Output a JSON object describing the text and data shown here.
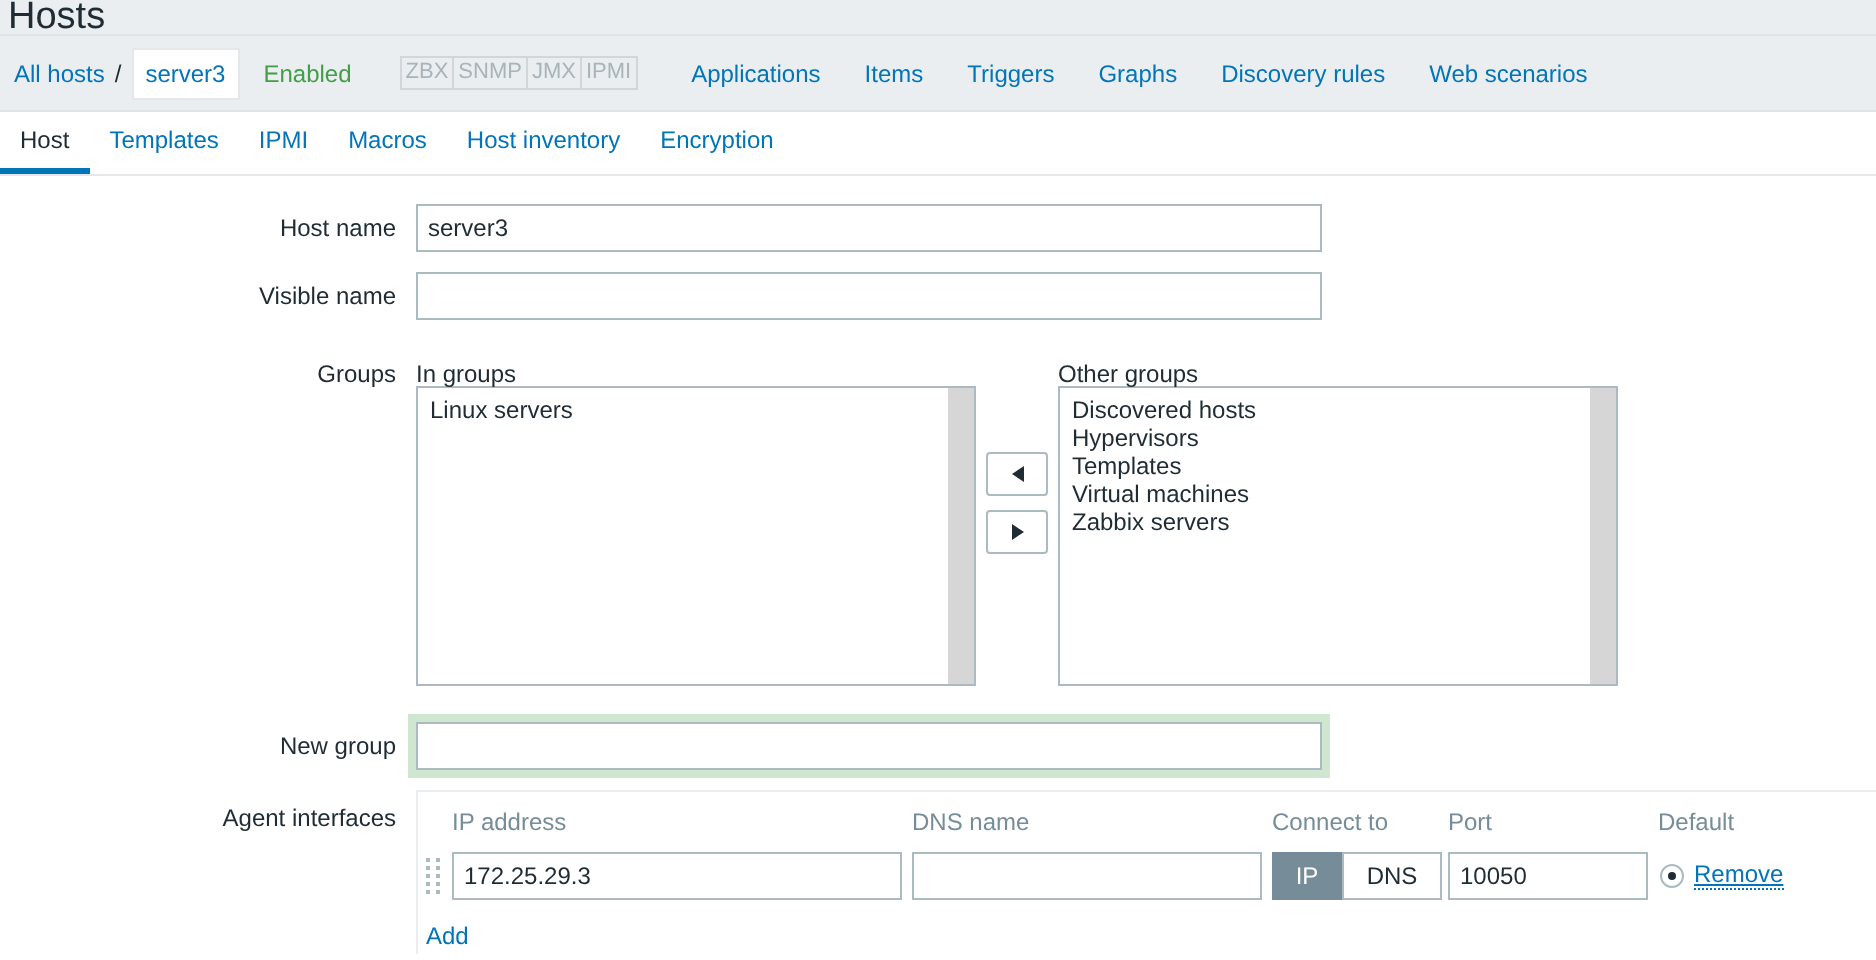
{
  "title": "Hosts",
  "nav": {
    "all_hosts": "All hosts",
    "separator": "/",
    "host": "server3",
    "status": "Enabled",
    "availability": [
      {
        "label": "ZBX"
      },
      {
        "label": "SNMP"
      },
      {
        "label": "JMX"
      },
      {
        "label": "IPMI"
      }
    ],
    "links": [
      "Applications",
      "Items",
      "Triggers",
      "Graphs",
      "Discovery rules",
      "Web scenarios"
    ]
  },
  "tabs": [
    {
      "label": "Host",
      "selected": true
    },
    {
      "label": "Templates",
      "selected": false
    },
    {
      "label": "IPMI",
      "selected": false
    },
    {
      "label": "Macros",
      "selected": false
    },
    {
      "label": "Host inventory",
      "selected": false
    },
    {
      "label": "Encryption",
      "selected": false
    }
  ],
  "form": {
    "host_name": {
      "label": "Host name",
      "value": "server3"
    },
    "visible_name": {
      "label": "Visible name"
    },
    "groups": {
      "label": "Groups",
      "in_groups_label": "In groups",
      "in_groups": [
        "Linux servers"
      ],
      "other_groups_label": "Other groups",
      "other_groups": [
        "Discovered hosts",
        "Hypervisors",
        "Templates",
        "Virtual machines",
        "Zabbix servers"
      ]
    },
    "new_group": {
      "label": "New group",
      "focused": true
    },
    "agent_interfaces": {
      "label": "Agent interfaces",
      "columns": [
        "IP address",
        "DNS name",
        "Connect to",
        "Port",
        "Default"
      ],
      "rows": [
        {
          "ip": "172.25.29.3",
          "dns": "",
          "connect": [
            {
              "label": "IP",
              "selected": true
            },
            {
              "label": "DNS",
              "selected": false
            }
          ],
          "port": "10050",
          "default": true,
          "remove": "Remove"
        }
      ],
      "add": "Add"
    }
  }
}
